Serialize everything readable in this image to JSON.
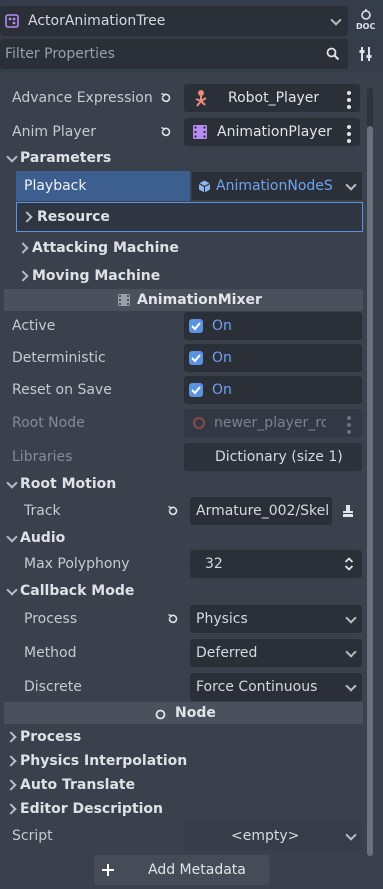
{
  "header": {
    "node_name": "ActorAnimationTree",
    "doc_label": "DOC",
    "filter_placeholder": "Filter Properties"
  },
  "properties": {
    "advance_expression": {
      "label": "Advance Expression B",
      "value": "Robot_Player"
    },
    "anim_player": {
      "label": "Anim Player",
      "value": "AnimationPlayer"
    },
    "parameters": {
      "label": "Parameters",
      "playback_label": "Playback",
      "playback_value": "AnimationNodeS",
      "resource_label": "Resource",
      "attacking_label": "Attacking Machine",
      "moving_label": "Moving Machine"
    },
    "mixer_header": "AnimationMixer",
    "active": {
      "label": "Active",
      "value": "On"
    },
    "deterministic": {
      "label": "Deterministic",
      "value": "On"
    },
    "reset_on_save": {
      "label": "Reset on Save",
      "value": "On"
    },
    "root_node": {
      "label": "Root Node",
      "value": "newer_player_ro"
    },
    "libraries": {
      "label": "Libraries",
      "value": "Dictionary (size 1)"
    },
    "root_motion": {
      "label": "Root Motion",
      "track_label": "Track",
      "track_value": "Armature_002/Skel"
    },
    "audio": {
      "label": "Audio",
      "max_polyphony_label": "Max Polyphony",
      "max_polyphony_value": "32"
    },
    "callback_mode": {
      "label": "Callback Mode",
      "process_label": "Process",
      "process_value": "Physics",
      "method_label": "Method",
      "method_value": "Deferred",
      "discrete_label": "Discrete",
      "discrete_value": "Force Continuous"
    },
    "node_header": "Node",
    "node_sections": [
      "Process",
      "Physics Interpolation",
      "Auto Translate",
      "Editor Description"
    ],
    "script": {
      "label": "Script",
      "value": "<empty>"
    },
    "add_metadata_label": "Add Metadata"
  },
  "colors": {
    "panel_bg": "#363d4a",
    "field_bg": "#2a2f38",
    "accent": "#5c93e0",
    "playback_highlight": "#3d5f8f",
    "section_header_bg": "#4a505c"
  }
}
